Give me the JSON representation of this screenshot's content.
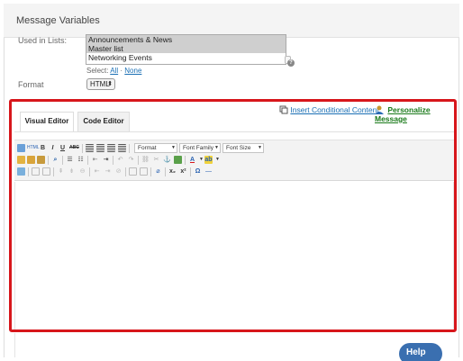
{
  "section": {
    "title": "Message Variables"
  },
  "used_in_lists": {
    "label": "Used in Lists:",
    "options": [
      {
        "label": "Announcements & News",
        "selected": true
      },
      {
        "label": "Master list",
        "selected": true
      },
      {
        "label": "Networking Events",
        "selected": false
      }
    ],
    "select_prefix": "Select:",
    "all_label": "All",
    "separator": "·",
    "none_label": "None",
    "help_icon": "?"
  },
  "format": {
    "label": "Format",
    "value": "HTML",
    "arrow": "⬍"
  },
  "editor": {
    "tabs": [
      {
        "label": "Visual Editor",
        "active": true
      },
      {
        "label": "Code Editor",
        "active": false
      }
    ],
    "insert_conditional_label": "Insert Conditional Content",
    "personalize_label": "Personalize Message",
    "toolbar": {
      "format_label": "Format",
      "font_family_label": "Font Family",
      "font_size_label": "Font Size",
      "bold": "B",
      "italic": "I",
      "underline": "U",
      "strike": "ABC",
      "subscript": "x₂",
      "superscript": "x²",
      "omega": "Ω"
    }
  },
  "help_button": {
    "label": "Help"
  },
  "colors": {
    "highlight_border": "#d7161b",
    "link_blue": "#1a6fb4",
    "personalize_green": "#1a7a1a",
    "help_blue": "#3a6fb0"
  }
}
